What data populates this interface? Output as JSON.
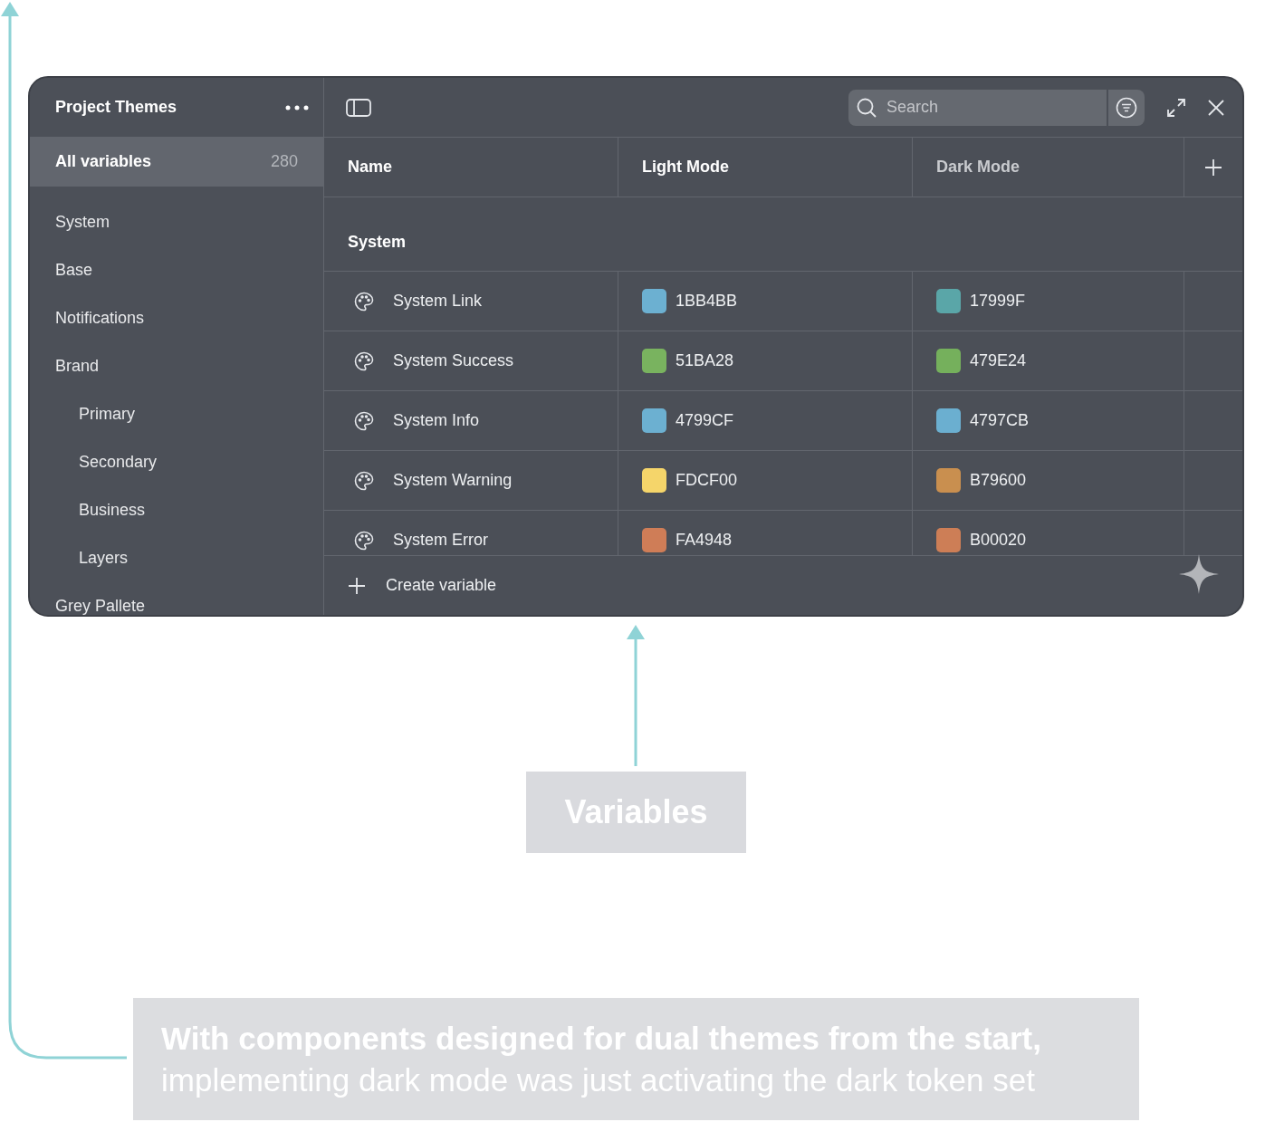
{
  "window": {
    "title": "Project Themes",
    "search": {
      "placeholder": "Search"
    }
  },
  "sidebar": {
    "items": [
      {
        "label": "All variables",
        "count": "280",
        "selected": true
      },
      {
        "label": "System",
        "selected": false
      },
      {
        "label": "Base",
        "selected": false
      },
      {
        "label": "Notifications",
        "selected": false
      },
      {
        "label": "Brand",
        "selected": false,
        "children": [
          {
            "label": "Primary",
            "selected": false
          },
          {
            "label": "Secondary",
            "selected": false
          },
          {
            "label": "Business",
            "selected": false
          },
          {
            "label": "Layers",
            "selected": false
          }
        ]
      },
      {
        "label": "Grey Pallete",
        "selected": false
      }
    ]
  },
  "table": {
    "columns": [
      "Name",
      "Light Mode",
      "Dark Mode"
    ],
    "group": "System",
    "rows": [
      {
        "name": "System Link",
        "light": {
          "value": "1BB4BB",
          "color": "#6cb0d1"
        },
        "dark": {
          "value": "17999F",
          "color": "#5aa6a8"
        }
      },
      {
        "name": "System Success",
        "light": {
          "value": "51BA28",
          "color": "#79b35f"
        },
        "dark": {
          "value": "479E24",
          "color": "#75b05c"
        }
      },
      {
        "name": "System Info",
        "light": {
          "value": "4799CF",
          "color": "#6cb0d1"
        },
        "dark": {
          "value": "4797CB",
          "color": "#6bafd0"
        }
      },
      {
        "name": "System Warning",
        "light": {
          "value": "FDCF00",
          "color": "#f5d56a"
        },
        "dark": {
          "value": "B79600",
          "color": "#c98f4f"
        }
      },
      {
        "name": "System Error",
        "light": {
          "value": "FA4948",
          "color": "#cf7d57"
        },
        "dark": {
          "value": "B00020",
          "color": "#cd7e56"
        }
      }
    ],
    "create_label": "Create variable"
  },
  "annotations": {
    "label": "Variables",
    "caption_bold": "With components designed for dual themes from the start,",
    "caption": "implementing dark mode was just activating the dark token set"
  }
}
